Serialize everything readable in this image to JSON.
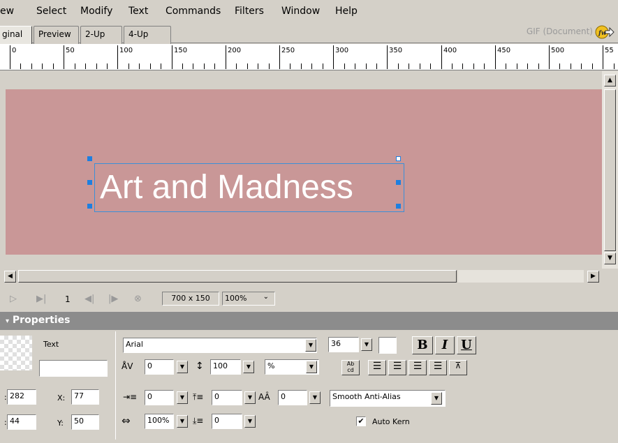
{
  "menu": {
    "items": [
      "ew",
      "Select",
      "Modify",
      "Text",
      "Commands",
      "Filters",
      "Window",
      "Help"
    ]
  },
  "tabs": {
    "items": [
      "ginal",
      "Preview",
      "2-Up",
      "4-Up"
    ],
    "active": "ginal"
  },
  "doc_info": "GIF (Document)",
  "ruler": {
    "labels": [
      "0",
      "50",
      "100",
      "150",
      "200",
      "250",
      "300",
      "350",
      "400",
      "450",
      "500",
      "55"
    ]
  },
  "canvas": {
    "text": "Art and Madness",
    "background": "#c99797",
    "text_color": "#ffffff",
    "selection_color": "#3a8fd8"
  },
  "status": {
    "frame": "1",
    "size": "700 x 150",
    "zoom": "100%"
  },
  "properties": {
    "title": "Properties",
    "object_type": "Text",
    "object_name": "",
    "w": "282",
    "h": "44",
    "x_label": "X:",
    "x": "77",
    "y_label": "Y:",
    "y": "50",
    "font": "Arial",
    "size": "36",
    "bold": "B",
    "italic": "I",
    "underline": "U",
    "kerning": "0",
    "leading": "100",
    "leading_unit": "%",
    "indent": "0",
    "space_before": "0",
    "baseline_shift": "0",
    "horizontal_scale": "100%",
    "space_after": "0",
    "antialias": "Smooth Anti-Alias",
    "auto_kern_label": "Auto Kern",
    "auto_kern_checked": true
  }
}
